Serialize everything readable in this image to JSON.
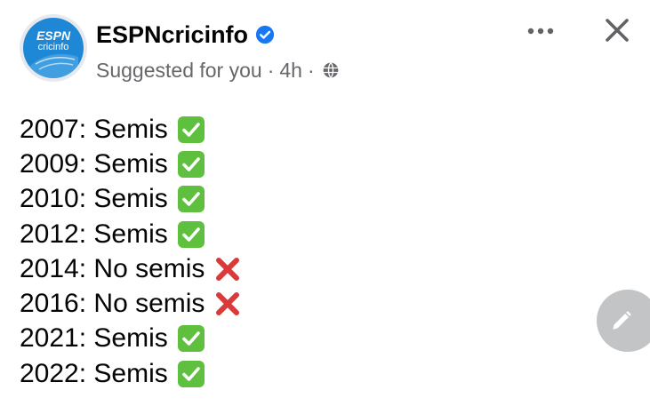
{
  "post": {
    "page_name": "ESPNcricinfo",
    "suggested": "Suggested for you",
    "separator": "·",
    "time": "4h",
    "avatar": {
      "espn_text": "ESPN",
      "cricinfo_text": "cricinfo"
    }
  },
  "content": {
    "lines": [
      {
        "text": "2007: Semis",
        "status": "check"
      },
      {
        "text": "2009: Semis",
        "status": "check"
      },
      {
        "text": "2010: Semis",
        "status": "check"
      },
      {
        "text": "2012: Semis",
        "status": "check"
      },
      {
        "text": "2014: No semis",
        "status": "cross"
      },
      {
        "text": "2016: No semis",
        "status": "cross"
      },
      {
        "text": "2021: Semis",
        "status": "check"
      },
      {
        "text": "2022: Semis",
        "status": "check"
      }
    ]
  },
  "icons": {
    "verified": "verified-badge-icon",
    "globe": "globe-icon",
    "more": "more-options-icon",
    "close": "close-icon",
    "check": "check-mark-icon",
    "cross": "cross-mark-icon",
    "edit": "pencil-icon"
  },
  "colors": {
    "brand_blue": "#1e88d6",
    "verified_blue": "#1877f2",
    "meta_gray": "#65676b",
    "check_green": "#5fbf3e",
    "cross_red": "#d93a3a",
    "fab_gray": "#c3c4c6"
  }
}
